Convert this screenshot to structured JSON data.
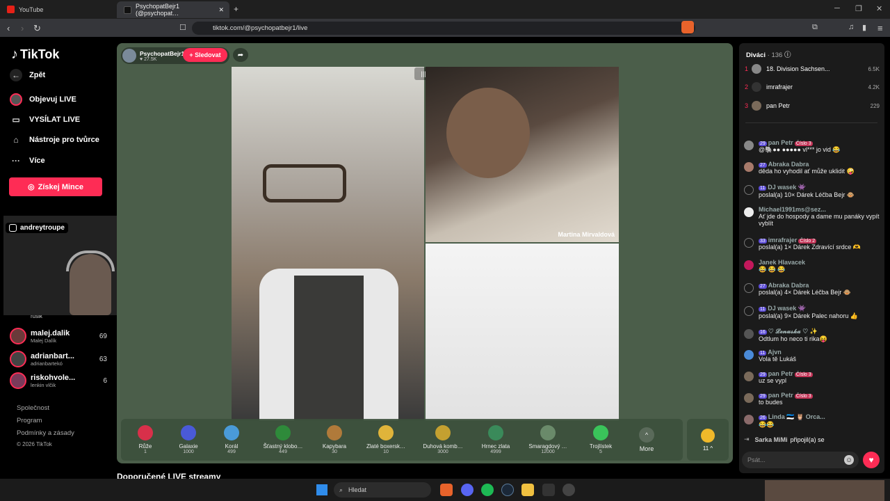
{
  "browser": {
    "tab1": "YouTube",
    "tab2": "PsychopatBejr1 (@psychopat…",
    "url": "tiktok.com/@psychopatbejr1/live",
    "new_tab": "+"
  },
  "nav": {
    "logo": "TikTok",
    "back": "Zpět",
    "items": [
      "Objevuj LIVE",
      "VYSÍLAT LIVE",
      "Nástroje pro tvůrce",
      "Více"
    ],
    "coins": "Získej Mince"
  },
  "overlay": {
    "username": "andreytroupe"
  },
  "following": [
    {
      "name": "rusik",
      "sub": "",
      "count": ""
    },
    {
      "name": "malej.dalik",
      "sub": "Malej Dalík",
      "count": "69"
    },
    {
      "name": "adrianbart...",
      "sub": "adrianbartekó",
      "count": "63"
    },
    {
      "name": "riskohvole...",
      "sub": "lenkin vlčik",
      "count": "6"
    }
  ],
  "footer": [
    "Společnost",
    "Program",
    "Podmínky a zásady",
    "© 2026 TikTok"
  ],
  "host": {
    "name": "PsychopatBejr1",
    "likes": "27.5K",
    "follow": "+ Sledovat"
  },
  "guest": {
    "name": "Martina Mirvaldová"
  },
  "gifts": [
    {
      "name": "Růže",
      "price": "1",
      "color": "#d8304a"
    },
    {
      "name": "Galaxie",
      "price": "1000",
      "color": "#4a5ad8"
    },
    {
      "name": "Korál",
      "price": "499",
      "color": "#4a9ad8"
    },
    {
      "name": "Šťastný klobo…",
      "price": "449",
      "color": "#2e8a3a"
    },
    {
      "name": "Kapybara",
      "price": "30",
      "color": "#b07a3a"
    },
    {
      "name": "Zlaté boxersk…",
      "price": "10",
      "color": "#e0b43a"
    },
    {
      "name": "Duhová komb…",
      "price": "3000",
      "color": "#c4a030"
    },
    {
      "name": "Hrnec zlata",
      "price": "4999",
      "color": "#3a8a5a"
    },
    {
      "name": "Smaragdový …",
      "price": "12000",
      "color": "#6a8a6a"
    },
    {
      "name": "Trojlístek",
      "price": "5",
      "color": "#3ac45a"
    }
  ],
  "gift_more": "More",
  "gift_coins": "11 ^",
  "recommended": "Doporučené LIVE streamy",
  "viewers": {
    "title": "Diváci",
    "count": "· 136",
    "list": [
      {
        "rank": "1",
        "name": "18. Division Sachsen...",
        "value": "6.5K"
      },
      {
        "rank": "2",
        "name": "imrafrajer",
        "value": "4.2K"
      },
      {
        "rank": "3",
        "name": "pan Petr",
        "value": "229"
      }
    ]
  },
  "chat": [
    {
      "lvl": "29",
      "user": "pan Petr",
      "badge": "Číslo 3",
      "text": "@🐘●● ●●●●● vl*** jo vid 😂"
    },
    {
      "lvl": "27",
      "user": "Abraka Dabra",
      "badge": "",
      "text": "děda ho vyhodil ať může uklidit 🤪"
    },
    {
      "lvl": "11",
      "user": "DJ wasek 👾",
      "badge": "",
      "text": "poslal(a) 10× Dárek Léčba Bejr 🐵"
    },
    {
      "lvl": "",
      "user": "Michael1991ms@sez...",
      "badge": "",
      "text": "Ať jde do hospody a dame mu panáky vypít vyblít"
    },
    {
      "lvl": "33",
      "user": "imrafrajer",
      "badge": "Číslo 2",
      "text": "poslal(a) 1× Dárek Zdravící srdce 🫶"
    },
    {
      "lvl": "",
      "user": "Janek Hlavacek",
      "badge": "",
      "text": "😂 😂 😂"
    },
    {
      "lvl": "27",
      "user": "Abraka Dabra",
      "badge": "",
      "text": "poslal(a) 4× Dárek Léčba Bejr 🐵"
    },
    {
      "lvl": "11",
      "user": "DJ wasek 👾",
      "badge": "",
      "text": "poslal(a) 9× Dárek Palec nahoru 👍"
    },
    {
      "lvl": "16",
      "user": "♡ 𝓛𝓮𝓷𝓾𝓼𝓴𝓪 ♡ ✨",
      "badge": "",
      "text": "Odtlum ho neco ti rika😝"
    },
    {
      "lvl": "11",
      "user": "Ajvn",
      "badge": "",
      "text": "Vola tě Lukáš"
    },
    {
      "lvl": "29",
      "user": "pan Petr",
      "badge": "Číslo 3",
      "text": "uz se vypl"
    },
    {
      "lvl": "29",
      "user": "pan Petr",
      "badge": "Číslo 3",
      "text": "to budes"
    },
    {
      "lvl": "26",
      "user": "Linda 🇪🇪 🦉 Orca...",
      "badge": "",
      "text": "😂😂"
    }
  ],
  "join": {
    "user": "Sarka MiMi",
    "text": "připojil(a) se"
  },
  "input_placeholder": "Psát...",
  "taskbar": {
    "search": "Hledat"
  }
}
